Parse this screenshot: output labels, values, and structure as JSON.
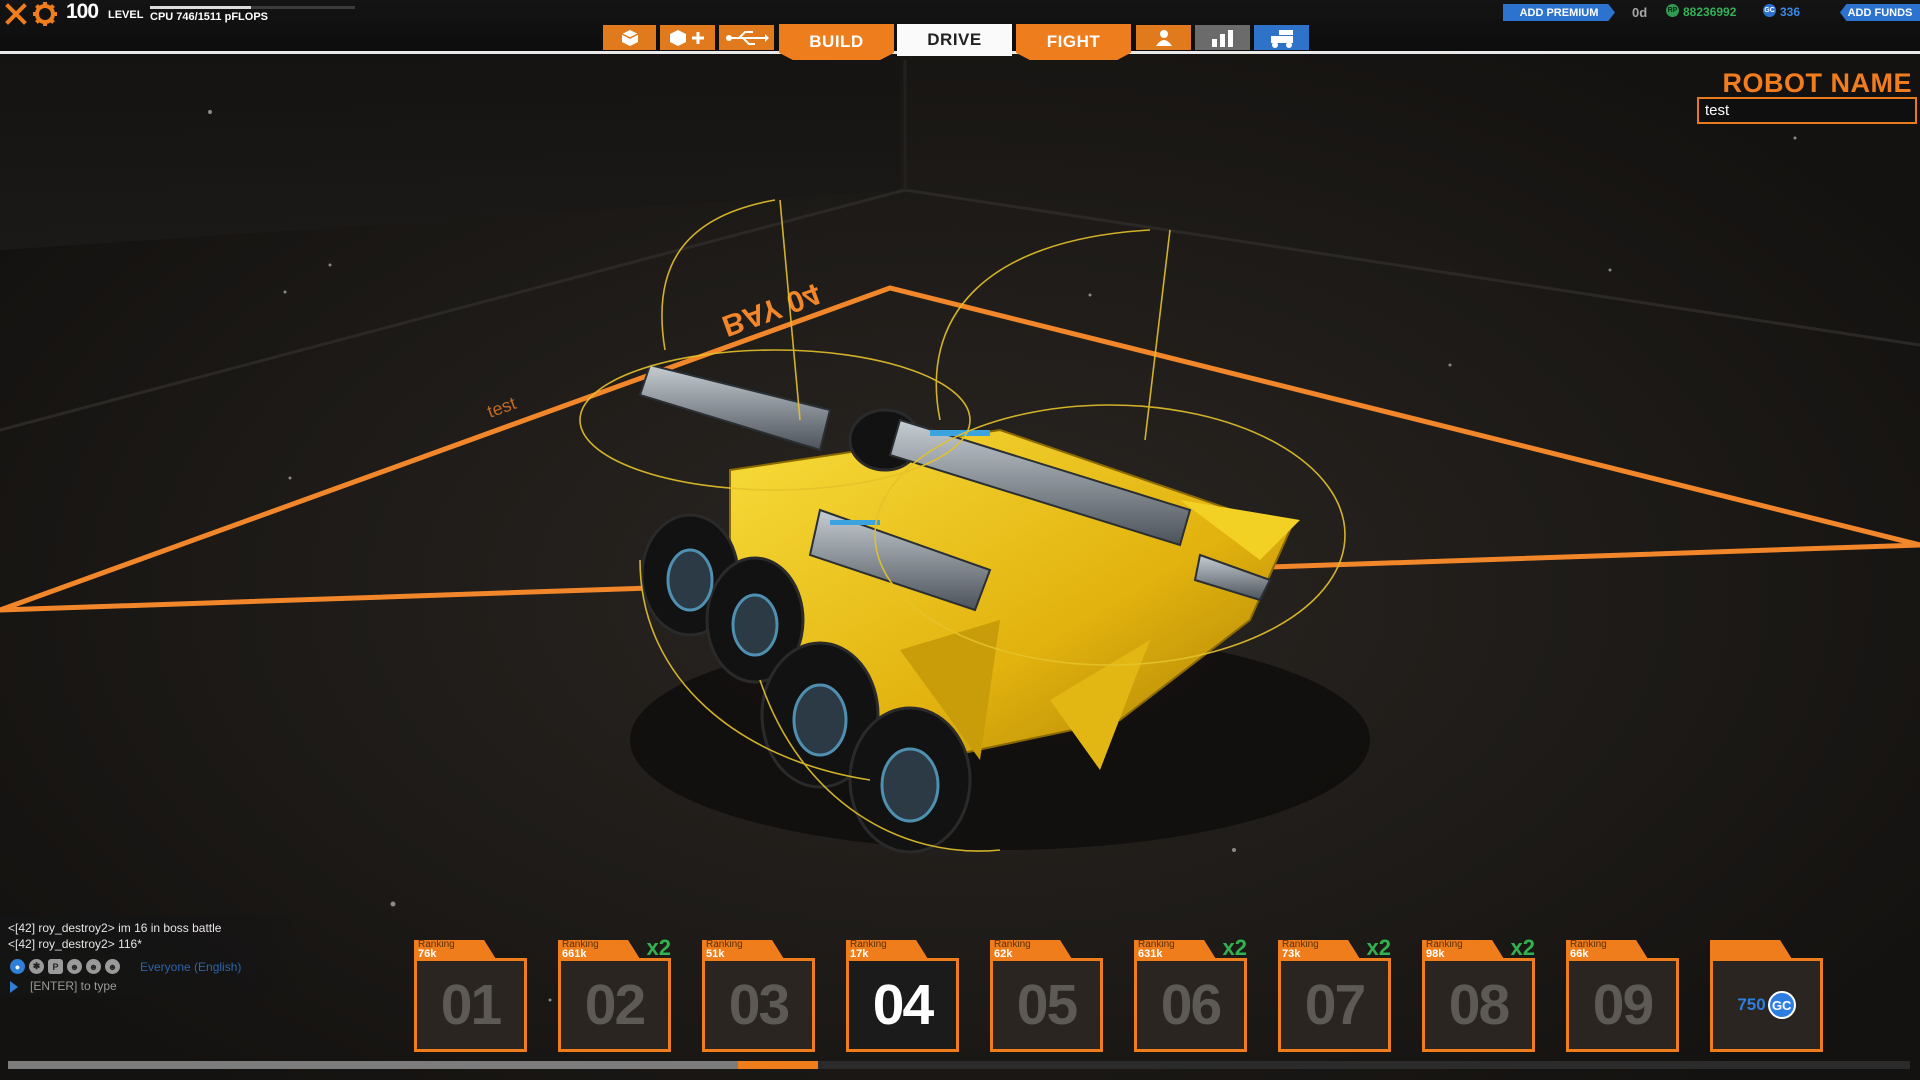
{
  "top_bar": {
    "level": "100",
    "level_label": "LEVEL",
    "cpu_text": "CPU 746/1511 pFLOPS",
    "cpu_fraction": 0.494,
    "add_premium": "ADD PREMIUM",
    "premium_days": "0d",
    "rp_icon": "RP",
    "robot_points": "88236992",
    "gc_icon": "GC",
    "galaxy_coins": "336",
    "add_funds": "ADD FUNDS"
  },
  "modes": {
    "build": "BUILD",
    "drive": "DRIVE",
    "fight": "FIGHT",
    "active": "DRIVE"
  },
  "toolbar_icons": [
    "cube-icon",
    "cube-add-icon",
    "usb-icon",
    "people-icon",
    "leaderboard-icon",
    "garage-icon"
  ],
  "robot": {
    "label": "ROBOT NAME",
    "name": "test",
    "floor_bay_label": "BAY 04",
    "floor_name_label": "test"
  },
  "chat": {
    "lines": [
      "<[42] roy_destroy2> im 16 in boss battle",
      "<[42] roy_destroy2> 116*"
    ],
    "channel_icon_labels": [
      "P"
    ],
    "channel": "Everyone (English)",
    "prompt": "[ENTER] to type"
  },
  "bays": [
    {
      "number": "01",
      "rank_label": "Ranking",
      "rank": "76k",
      "multiplier": "",
      "active": false
    },
    {
      "number": "02",
      "rank_label": "Ranking",
      "rank": "661k",
      "multiplier": "x2",
      "active": false
    },
    {
      "number": "03",
      "rank_label": "Ranking",
      "rank": "51k",
      "multiplier": "",
      "active": false
    },
    {
      "number": "04",
      "rank_label": "Ranking",
      "rank": "17k",
      "multiplier": "",
      "active": true
    },
    {
      "number": "05",
      "rank_label": "Ranking",
      "rank": "62k",
      "multiplier": "",
      "active": false
    },
    {
      "number": "06",
      "rank_label": "Ranking",
      "rank": "631k",
      "multiplier": "x2",
      "active": false
    },
    {
      "number": "07",
      "rank_label": "Ranking",
      "rank": "73k",
      "multiplier": "x2",
      "active": false
    },
    {
      "number": "08",
      "rank_label": "Ranking",
      "rank": "98k",
      "multiplier": "x2",
      "active": false
    },
    {
      "number": "09",
      "rank_label": "Ranking",
      "rank": "66k",
      "multiplier": "",
      "active": false
    }
  ],
  "buy_bay": {
    "price": "750",
    "currency": "GC"
  },
  "colors": {
    "accent": "#f07d1c",
    "premium_blue": "#2c73cf",
    "rp_green": "#33b05a",
    "multiplier_green": "#32b24f",
    "robot_yellow": "#f2c515"
  }
}
